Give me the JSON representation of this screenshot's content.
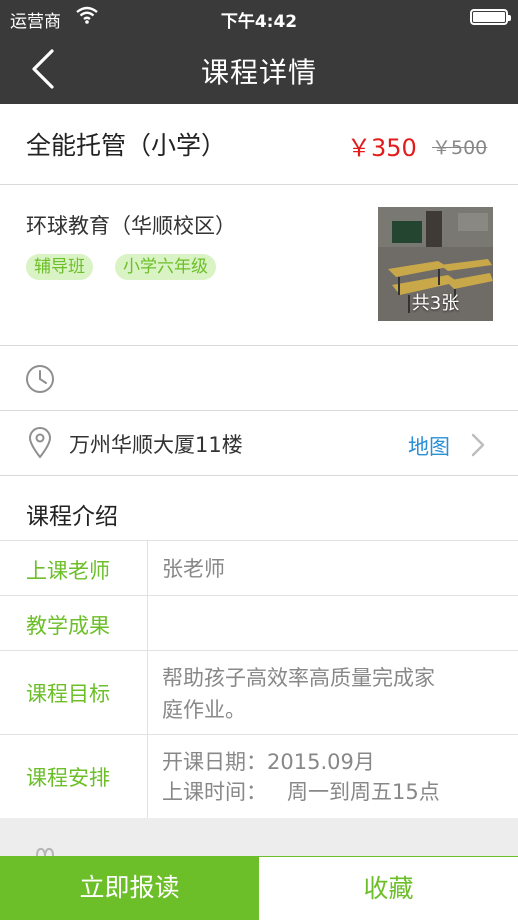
{
  "status_bar": {
    "carrier": "运营商",
    "time": "下午4:42"
  },
  "nav": {
    "title": "课程详情",
    "back_icon": "chevron-left-icon"
  },
  "course": {
    "title": "全能托管（小学）",
    "price": "￥350",
    "original_price": "￥500",
    "school": "环球教育（华顺校区）",
    "tags": [
      "辅导班",
      "小学六年级"
    ],
    "photo_count": "共3张"
  },
  "schedule": {
    "icon": "clock-icon"
  },
  "location": {
    "icon": "location-pin-icon",
    "address": "万州华顺大厦11楼",
    "map_label": "地图"
  },
  "intro": {
    "title": "课程介绍",
    "rows": [
      {
        "label": "上课老师",
        "lines": [
          "张老师"
        ]
      },
      {
        "label": "教学成果",
        "lines": []
      },
      {
        "label": "课程目标",
        "lines": [
          "帮助孩子高效率高质量完成家",
          "庭作业。"
        ]
      },
      {
        "label": "课程安排",
        "lines": [
          "开课日期：2015.09月",
          "上课时间：   周一到周五15点"
        ]
      }
    ]
  },
  "actions": {
    "enroll": "立即报读",
    "favorite": "收藏"
  },
  "colors": {
    "accent_green": "#6cbf29",
    "price_red": "#e31b1b",
    "link_blue": "#2b8fd6",
    "header_dark": "#3a3a3a"
  }
}
